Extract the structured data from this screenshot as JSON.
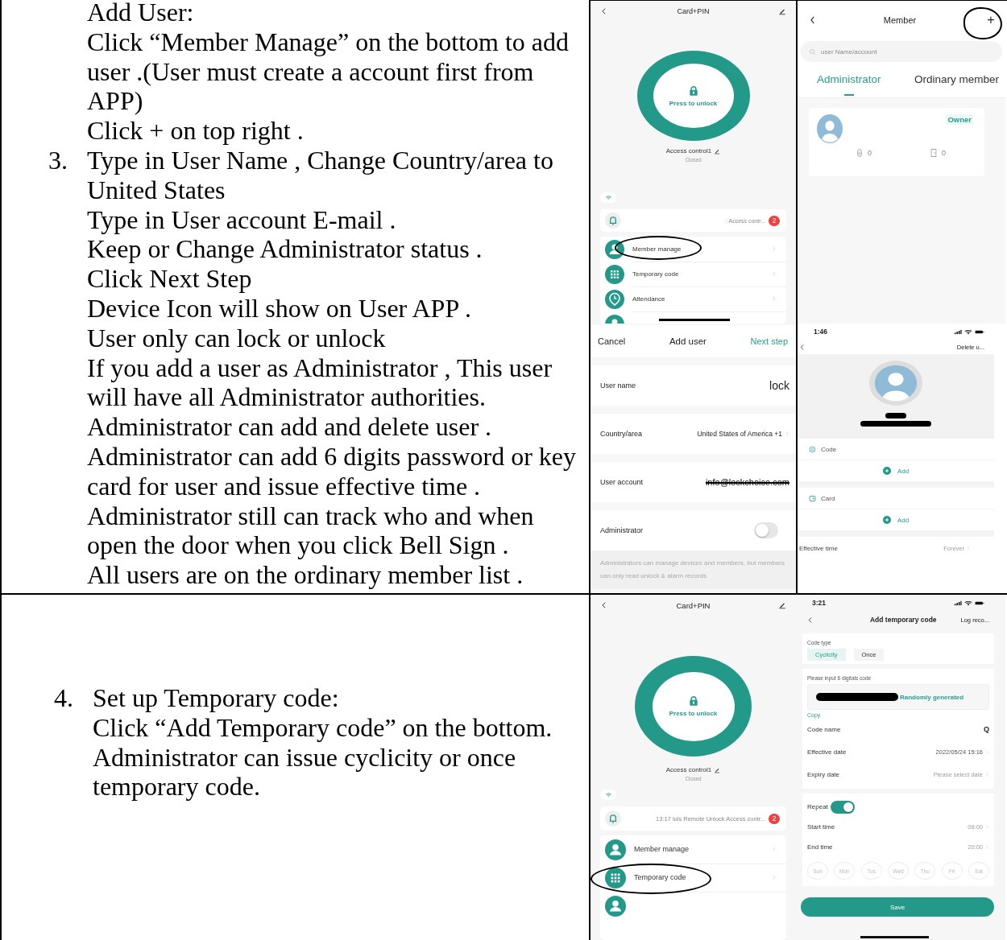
{
  "rows": [
    {
      "instructions": [
        {
          "kind": "line",
          "text": "Add User:"
        },
        {
          "kind": "line",
          "text": "Click “Member Manage” on the bottom to add user .(User must create a account first from APP)"
        },
        {
          "kind": "line",
          "text": "Click + on top right ."
        },
        {
          "kind": "numbered",
          "number": "3.",
          "text": "Type in User Name , Change Country/area to United States"
        },
        {
          "kind": "line",
          "text": "Type in User account E-mail ."
        },
        {
          "kind": "line",
          "text": "Keep or Change Administrator status ."
        },
        {
          "kind": "line",
          "text": "Click Next Step"
        },
        {
          "kind": "line",
          "text": "Device Icon will show on User APP ."
        },
        {
          "kind": "line",
          "text": "User only can lock or unlock"
        },
        {
          "kind": "line",
          "text": "If you add a user as Administrator , This user will have all Administrator authorities."
        },
        {
          "kind": "line",
          "text": "Administrator can add and delete user ."
        },
        {
          "kind": "line",
          "text": "Administrator can add 6 digits password or key card for user and issue effective time ."
        },
        {
          "kind": "line",
          "text": "Administrator still can track who and when open the door when you click Bell Sign ."
        },
        {
          "kind": "line",
          "text": "All users are on the ordinary member list ."
        }
      ],
      "screens": [
        {
          "kind": "device",
          "title": "Card+PIN",
          "unlock_label": "Press to unlock",
          "device_name": "Access control1",
          "device_status": "Closed",
          "notification": ": Access contr...",
          "badge": "2",
          "menu": [
            {
              "label": "Member manage",
              "circled": true
            },
            {
              "label": "Temporary code",
              "circled": false
            },
            {
              "label": "Attendance",
              "circled": false
            }
          ]
        },
        {
          "kind": "member",
          "title": "Member",
          "add_label": "+",
          "add_circled": true,
          "search_placeholder": "user Name/account",
          "tabs": [
            {
              "label": "Administrator",
              "selected": true
            },
            {
              "label": "Ordinary member",
              "selected": false
            }
          ],
          "owner_badge": "Owner",
          "code_count": "0",
          "card_count": "0"
        },
        {
          "kind": "add_user",
          "cancel": "Cancel",
          "title": "Add user",
          "next": "Next step",
          "fields": [
            {
              "kind": "text",
              "label": "User name",
              "value": "lock"
            },
            {
              "kind": "select",
              "label": "Country/area",
              "value": "United States of America +1"
            },
            {
              "kind": "text",
              "label": "User account",
              "value": "info@lockchoice.com",
              "struck": true
            },
            {
              "kind": "toggle",
              "label": "Administrator",
              "on": false
            }
          ],
          "note": "Administrators can manage devices and members, but members can only read unlock & alarm records"
        },
        {
          "kind": "user_detail",
          "time": "1:46",
          "action": "Delete u...",
          "credentials": [
            {
              "kind": "code",
              "label": "Code",
              "action": "Add"
            },
            {
              "kind": "card",
              "label": "Card",
              "action": "Add"
            }
          ],
          "effective_label": "Effective time",
          "effective_value": "Forever"
        }
      ]
    },
    {
      "instructions": [
        {
          "kind": "numbered",
          "number": "4.",
          "text": "Set up Temporary code:"
        },
        {
          "kind": "line",
          "text": "Click “Add Temporary code” on the bottom."
        },
        {
          "kind": "line",
          "text": "Administrator can issue cyclicity or once temporary code."
        }
      ],
      "screens": [
        {
          "kind": "device",
          "title": "Card+PIN",
          "unlock_label": "Press to unlock",
          "device_name": "Access control1",
          "device_status": "Closed",
          "notification": "13:17 luis  Remote Unlock Access contr...",
          "badge": "2",
          "menu": [
            {
              "label": "Member manage",
              "circled": false
            },
            {
              "label": "Temporary code",
              "circled": true
            }
          ]
        },
        {
          "kind": "temp_code",
          "time": "3:21",
          "title": "Add temporary code",
          "action": "Log reco...",
          "code_type_label": "Code type",
          "code_types": [
            {
              "label": "Cyclicity",
              "selected": true
            },
            {
              "label": "Once",
              "selected": false
            }
          ],
          "code_label": "Please input 6 digitals code",
          "generate": "Randomly generated",
          "copy": "Copy",
          "rows": [
            {
              "kind": "value",
              "label": "Code name",
              "value": "Q",
              "chevron": false
            },
            {
              "kind": "value",
              "label": "Effective date",
              "value": "2022/05/24 15:16",
              "muted": false,
              "chevron": true
            },
            {
              "kind": "value",
              "label": "Expiry date",
              "value": "Please select date",
              "muted": true,
              "chevron": true
            }
          ],
          "repeat_rows": [
            {
              "kind": "toggle",
              "label": "Repeat",
              "on": true
            },
            {
              "kind": "value",
              "label": "Start time",
              "value": "08:00",
              "muted": true,
              "chevron": true
            },
            {
              "kind": "value",
              "label": "End time",
              "value": "20:00",
              "muted": true,
              "chevron": true
            }
          ],
          "days": [
            {
              "label": "Sun",
              "selected": false
            },
            {
              "label": "Mon",
              "selected": false
            },
            {
              "label": "Tus",
              "selected": false
            },
            {
              "label": "Wed",
              "selected": false
            },
            {
              "label": "Thu",
              "selected": false
            },
            {
              "label": "Fri",
              "selected": false
            },
            {
              "label": "Sat",
              "selected": false
            }
          ],
          "save": "Save"
        }
      ]
    }
  ]
}
